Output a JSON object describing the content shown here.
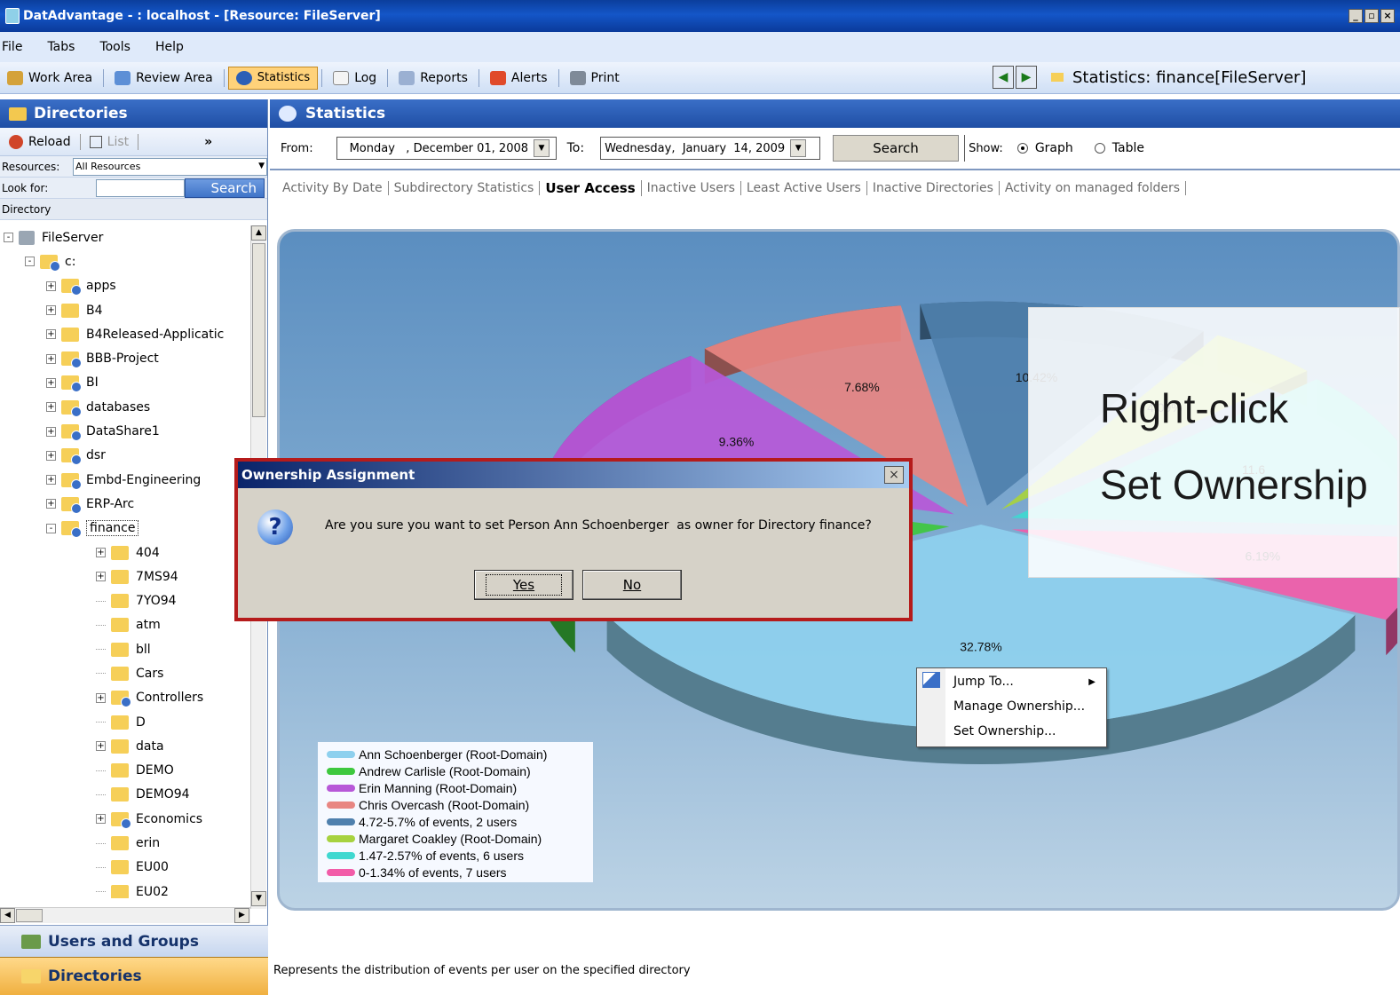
{
  "window": {
    "title": "DatAdvantage - : localhost - [Resource: FileServer]"
  },
  "menu": [
    "File",
    "Tabs",
    "Tools",
    "Help"
  ],
  "toolbar": {
    "items": [
      "Work Area",
      "Review Area",
      "Statistics",
      "Log",
      "Reports",
      "Alerts",
      "Print"
    ],
    "active": "Statistics",
    "nav_title": "Statistics: finance[FileServer]"
  },
  "left_panel": {
    "header": "Directories",
    "reload_label": "Reload",
    "list_label": "List",
    "resources_label": "Resources:",
    "resources_value": "All Resources",
    "look_for_label": "Look for:",
    "search_label": "Search",
    "column_header": "Directory",
    "tree": [
      {
        "label": "FileServer",
        "level": 0,
        "expander": "-",
        "icon": "server"
      },
      {
        "label": "c:",
        "level": 1,
        "expander": "-",
        "icon": "share"
      },
      {
        "label": "apps",
        "level": 2,
        "expander": "+",
        "icon": "share"
      },
      {
        "label": "B4",
        "level": 2,
        "expander": "+",
        "icon": "folder"
      },
      {
        "label": "B4Released-Applicatic",
        "level": 2,
        "expander": "+",
        "icon": "folder"
      },
      {
        "label": "BBB-Project",
        "level": 2,
        "expander": "+",
        "icon": "share"
      },
      {
        "label": "BI",
        "level": 2,
        "expander": "+",
        "icon": "share"
      },
      {
        "label": "databases",
        "level": 2,
        "expander": "+",
        "icon": "share"
      },
      {
        "label": "DataShare1",
        "level": 2,
        "expander": "+",
        "icon": "share"
      },
      {
        "label": "dsr",
        "level": 2,
        "expander": "+",
        "icon": "share"
      },
      {
        "label": "Embd-Engineering",
        "level": 2,
        "expander": "+",
        "icon": "share"
      },
      {
        "label": "ERP-Arc",
        "level": 2,
        "expander": "+",
        "icon": "share"
      },
      {
        "label": "finance",
        "level": 2,
        "expander": "-",
        "icon": "share",
        "selected": true
      },
      {
        "label": "404",
        "level": 3,
        "expander": "+",
        "icon": "folder"
      },
      {
        "label": "7MS94",
        "level": 3,
        "expander": "+",
        "icon": "folder"
      },
      {
        "label": "7YO94",
        "level": 3,
        "expander": "",
        "icon": "folder"
      },
      {
        "label": "atm",
        "level": 3,
        "expander": "",
        "icon": "folder"
      },
      {
        "label": "bll",
        "level": 3,
        "expander": "",
        "icon": "folder"
      },
      {
        "label": "Cars",
        "level": 3,
        "expander": "",
        "icon": "folder"
      },
      {
        "label": "Controllers",
        "level": 3,
        "expander": "+",
        "icon": "share"
      },
      {
        "label": "D",
        "level": 3,
        "expander": "",
        "icon": "folder"
      },
      {
        "label": "data",
        "level": 3,
        "expander": "+",
        "icon": "folder"
      },
      {
        "label": "DEMO",
        "level": 3,
        "expander": "",
        "icon": "folder"
      },
      {
        "label": "DEMO94",
        "level": 3,
        "expander": "",
        "icon": "folder"
      },
      {
        "label": "Economics",
        "level": 3,
        "expander": "+",
        "icon": "share"
      },
      {
        "label": "erin",
        "level": 3,
        "expander": "",
        "icon": "folder"
      },
      {
        "label": "EU00",
        "level": 3,
        "expander": "",
        "icon": "folder"
      },
      {
        "label": "EU02",
        "level": 3,
        "expander": "",
        "icon": "folder"
      }
    ],
    "bottom_tabs": [
      "Users and Groups",
      "Directories"
    ]
  },
  "main": {
    "header": "Statistics",
    "from_label": "From:",
    "from_date": "Monday   , December 01, 2008",
    "to_label": "To:",
    "to_date": "Wednesday,  January  14, 2009",
    "search_button": "Search",
    "show_label": "Show:",
    "show_graph": "Graph",
    "show_table": "Table",
    "tabs": [
      "Activity By Date",
      "Subdirectory Statistics",
      "User Access",
      "Inactive Users",
      "Least Active Users",
      "Inactive Directories",
      "Activity on managed folders"
    ],
    "active_tab": "User Access",
    "footnote": "Represents the distribution of events per user on the specified directory"
  },
  "chart_data": {
    "type": "pie",
    "slices": [
      {
        "name": "Ann Schoenberger (Root-Domain)",
        "value": 32.78,
        "label": "32.78%",
        "color": "#8ed0ee"
      },
      {
        "name": "Andrew Carlisle (Root-Domain)",
        "value": 10.5,
        "label": "",
        "color": "#3ec83e"
      },
      {
        "name": "Erin Manning (Root-Domain)",
        "value": 9.36,
        "label": "9.36%",
        "color": "#b758d8"
      },
      {
        "name": "Chris Overcash (Root-Domain)",
        "value": 7.68,
        "label": "7.68%",
        "color": "#e88682"
      },
      {
        "name": "4.72-5.7% of events, 2 users",
        "value": 10.42,
        "label": "10.42%",
        "color": "#4f80ad"
      },
      {
        "name": "Margaret Coakley (Root-Domain)",
        "value": 4.09,
        "label": "4.09%",
        "color": "#a7d23f"
      },
      {
        "name": "1.47-2.57% of events, 6 users",
        "value": 11.6,
        "label": "11.6",
        "color": "#3fd8d0"
      },
      {
        "name": "0-1.34% of events, 7 users",
        "value": 6.19,
        "label": "6.19%",
        "color": "#f25ca8"
      }
    ]
  },
  "context_menu": {
    "items": [
      "Jump To...",
      "Manage Ownership...",
      "Set Ownership..."
    ]
  },
  "hint": {
    "line1": "Right-click",
    "line2": "Set Ownership"
  },
  "dialog": {
    "title": "Ownership Assignment",
    "message": "Are you sure you want to set Person Ann Schoenberger  as owner for Directory finance?",
    "yes": "Yes",
    "no": "No"
  }
}
